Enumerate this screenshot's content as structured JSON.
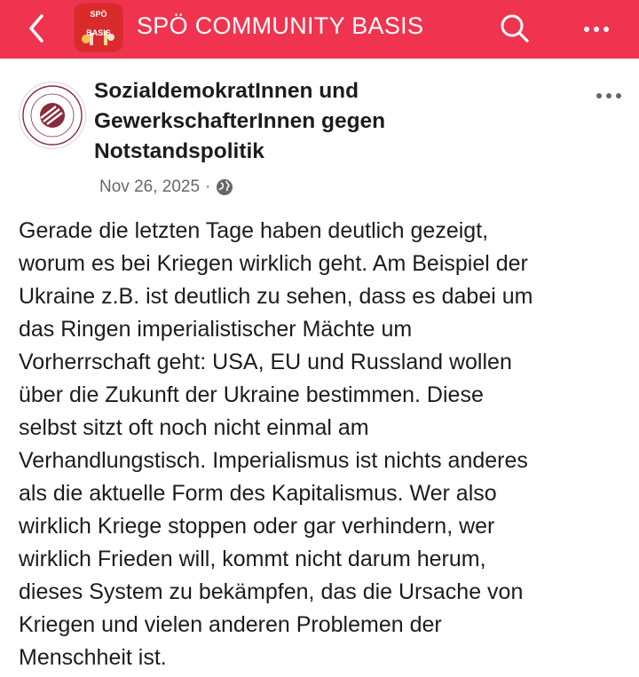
{
  "header": {
    "title": "SPÖ COMMUNITY BASIS",
    "avatar_text_top": "SPÖ",
    "avatar_text_bottom": "BASIS",
    "accent_color": "#f0334f",
    "icons": {
      "back": "back-arrow-icon",
      "search": "search-icon",
      "more": "more-icon"
    }
  },
  "post": {
    "author": "SozialdemokratInnen und GewerkschafterInnen gegen Notstandspolitik",
    "date": "Nov 26, 2025",
    "separator": "·",
    "audience_icon": "globe-icon",
    "more_icon": "more-icon",
    "text": "Gerade die letzten Tage haben deutlich gezeigt,\nworum es bei Kriegen wirklich geht. Am Beispiel der\nUkraine z.B. ist deutlich zu sehen, dass es dabei um\ndas Ringen imperialistischer Mächte um\nVorherrschaft geht: USA, EU und Russland wollen\nüber die Zukunft der Ukraine bestimmen. Diese\nselbst sitzt oft noch nicht einmal am\nVerhandlungstisch. Imperialismus ist nichts anderes\nals die aktuelle Form des Kapitalismus. Wer also\nwirklich Kriege stoppen oder gar verhindern, wer\nwirklich Frieden will, kommt nicht darum herum,\ndieses System zu bekämpfen, das die Ursache von\nKriegen und vielen anderen Problemen der\nMenschheit ist."
  }
}
